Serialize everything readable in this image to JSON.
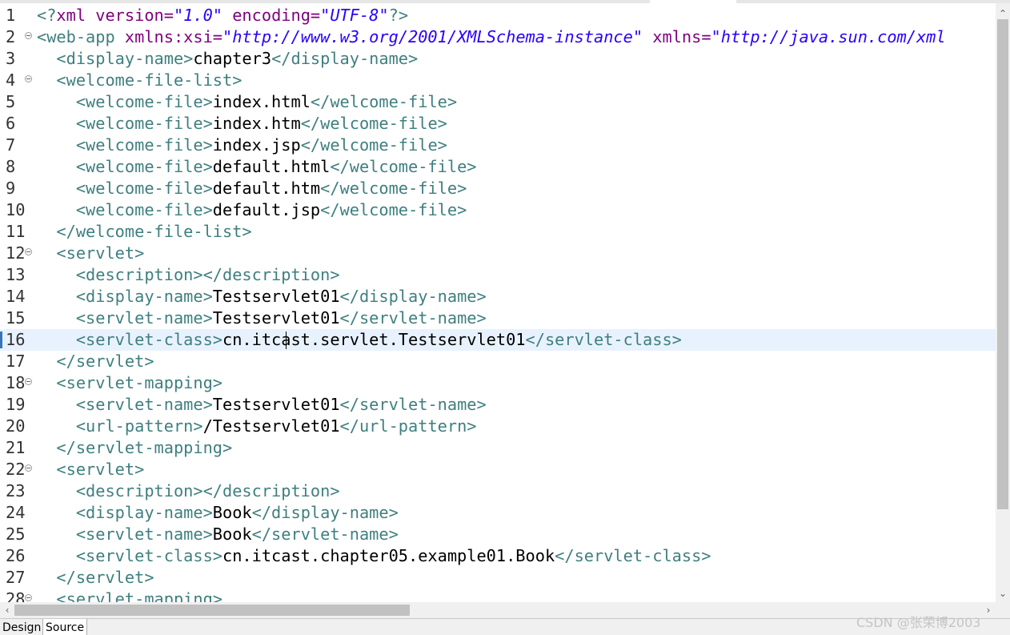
{
  "tabs": {
    "design": "Design",
    "source": "Source"
  },
  "watermark": "CSDN @张荣博2003",
  "lines": [
    {
      "n": "1",
      "fold": false,
      "segs": [
        [
          "t",
          "<?"
        ],
        [
          "a",
          "xml "
        ],
        [
          "a",
          "version="
        ],
        [
          "v",
          "\"1.0\""
        ],
        [
          "a",
          " encoding="
        ],
        [
          "v",
          "\"UTF-8\""
        ],
        [
          "t",
          "?>"
        ]
      ]
    },
    {
      "n": "2",
      "fold": true,
      "segs": [
        [
          "t",
          "<web-app "
        ],
        [
          "a",
          "xmlns:xsi="
        ],
        [
          "v",
          "\"http://www.w3.org/2001/XMLSchema-instance\""
        ],
        [
          "a",
          " xmlns="
        ],
        [
          "v",
          "\"http://java.sun.com/xml"
        ]
      ]
    },
    {
      "n": "3",
      "fold": false,
      "segs": [
        [
          "x",
          "  "
        ],
        [
          "t",
          "<display-name>"
        ],
        [
          "x",
          "chapter3"
        ],
        [
          "t",
          "</display-name>"
        ]
      ]
    },
    {
      "n": "4",
      "fold": true,
      "segs": [
        [
          "x",
          "  "
        ],
        [
          "t",
          "<welcome-file-list>"
        ]
      ]
    },
    {
      "n": "5",
      "fold": false,
      "segs": [
        [
          "x",
          "    "
        ],
        [
          "t",
          "<welcome-file>"
        ],
        [
          "x",
          "index.html"
        ],
        [
          "t",
          "</welcome-file>"
        ]
      ]
    },
    {
      "n": "6",
      "fold": false,
      "segs": [
        [
          "x",
          "    "
        ],
        [
          "t",
          "<welcome-file>"
        ],
        [
          "x",
          "index.htm"
        ],
        [
          "t",
          "</welcome-file>"
        ]
      ]
    },
    {
      "n": "7",
      "fold": false,
      "segs": [
        [
          "x",
          "    "
        ],
        [
          "t",
          "<welcome-file>"
        ],
        [
          "x",
          "index.jsp"
        ],
        [
          "t",
          "</welcome-file>"
        ]
      ]
    },
    {
      "n": "8",
      "fold": false,
      "segs": [
        [
          "x",
          "    "
        ],
        [
          "t",
          "<welcome-file>"
        ],
        [
          "x",
          "default.html"
        ],
        [
          "t",
          "</welcome-file>"
        ]
      ]
    },
    {
      "n": "9",
      "fold": false,
      "segs": [
        [
          "x",
          "    "
        ],
        [
          "t",
          "<welcome-file>"
        ],
        [
          "x",
          "default.htm"
        ],
        [
          "t",
          "</welcome-file>"
        ]
      ]
    },
    {
      "n": "10",
      "fold": false,
      "segs": [
        [
          "x",
          "    "
        ],
        [
          "t",
          "<welcome-file>"
        ],
        [
          "x",
          "default.jsp"
        ],
        [
          "t",
          "</welcome-file>"
        ]
      ]
    },
    {
      "n": "11",
      "fold": false,
      "segs": [
        [
          "x",
          "  "
        ],
        [
          "t",
          "</welcome-file-list>"
        ]
      ]
    },
    {
      "n": "12",
      "fold": true,
      "segs": [
        [
          "x",
          "  "
        ],
        [
          "t",
          "<servlet>"
        ]
      ]
    },
    {
      "n": "13",
      "fold": false,
      "segs": [
        [
          "x",
          "    "
        ],
        [
          "t",
          "<description></description>"
        ]
      ]
    },
    {
      "n": "14",
      "fold": false,
      "segs": [
        [
          "x",
          "    "
        ],
        [
          "t",
          "<display-name>"
        ],
        [
          "x",
          "Testservlet01"
        ],
        [
          "t",
          "</display-name>"
        ]
      ]
    },
    {
      "n": "15",
      "fold": false,
      "segs": [
        [
          "x",
          "    "
        ],
        [
          "t",
          "<servlet-name>"
        ],
        [
          "x",
          "Testservlet01"
        ],
        [
          "t",
          "</servlet-name>"
        ]
      ]
    },
    {
      "n": "16",
      "fold": false,
      "current": true,
      "segs": [
        [
          "x",
          "    "
        ],
        [
          "t",
          "<servlet-class>"
        ],
        [
          "x",
          "cn.itcast.servlet.Testservlet01"
        ],
        [
          "t",
          "</servlet-class>"
        ]
      ]
    },
    {
      "n": "17",
      "fold": false,
      "segs": [
        [
          "x",
          "  "
        ],
        [
          "t",
          "</servlet>"
        ]
      ]
    },
    {
      "n": "18",
      "fold": true,
      "segs": [
        [
          "x",
          "  "
        ],
        [
          "t",
          "<servlet-mapping>"
        ]
      ]
    },
    {
      "n": "19",
      "fold": false,
      "segs": [
        [
          "x",
          "    "
        ],
        [
          "t",
          "<servlet-name>"
        ],
        [
          "x",
          "Testservlet01"
        ],
        [
          "t",
          "</servlet-name>"
        ]
      ]
    },
    {
      "n": "20",
      "fold": false,
      "segs": [
        [
          "x",
          "    "
        ],
        [
          "t",
          "<url-pattern>"
        ],
        [
          "x",
          "/Testservlet01"
        ],
        [
          "t",
          "</url-pattern>"
        ]
      ]
    },
    {
      "n": "21",
      "fold": false,
      "segs": [
        [
          "x",
          "  "
        ],
        [
          "t",
          "</servlet-mapping>"
        ]
      ]
    },
    {
      "n": "22",
      "fold": true,
      "segs": [
        [
          "x",
          "  "
        ],
        [
          "t",
          "<servlet>"
        ]
      ]
    },
    {
      "n": "23",
      "fold": false,
      "segs": [
        [
          "x",
          "    "
        ],
        [
          "t",
          "<description></description>"
        ]
      ]
    },
    {
      "n": "24",
      "fold": false,
      "segs": [
        [
          "x",
          "    "
        ],
        [
          "t",
          "<display-name>"
        ],
        [
          "x",
          "Book"
        ],
        [
          "t",
          "</display-name>"
        ]
      ]
    },
    {
      "n": "25",
      "fold": false,
      "segs": [
        [
          "x",
          "    "
        ],
        [
          "t",
          "<servlet-name>"
        ],
        [
          "x",
          "Book"
        ],
        [
          "t",
          "</servlet-name>"
        ]
      ]
    },
    {
      "n": "26",
      "fold": false,
      "segs": [
        [
          "x",
          "    "
        ],
        [
          "t",
          "<servlet-class>"
        ],
        [
          "x",
          "cn.itcast.chapter05.example01.Book"
        ],
        [
          "t",
          "</servlet-class>"
        ]
      ]
    },
    {
      "n": "27",
      "fold": false,
      "segs": [
        [
          "x",
          "  "
        ],
        [
          "t",
          "</servlet>"
        ]
      ]
    },
    {
      "n": "28",
      "fold": true,
      "segs": [
        [
          "x",
          "  "
        ],
        [
          "t",
          "<servlet-mapping>"
        ]
      ]
    }
  ]
}
